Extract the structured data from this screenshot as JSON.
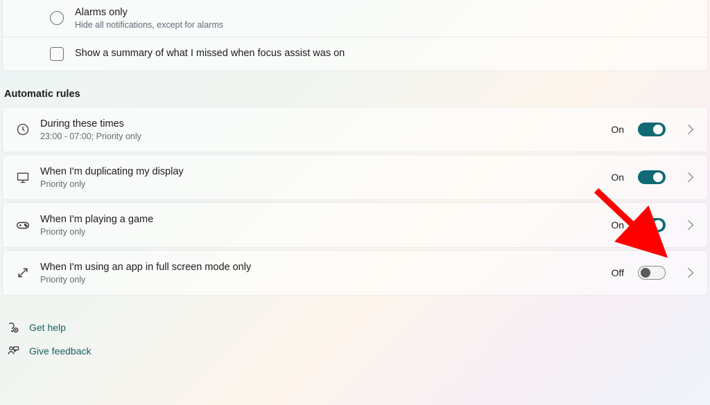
{
  "focus_options": {
    "alarms_only": {
      "title": "Alarms only",
      "subtitle": "Hide all notifications, except for alarms"
    },
    "summary_checkbox_label": "Show a summary of what I missed when focus assist was on"
  },
  "automatic_rules_header": "Automatic rules",
  "rules": [
    {
      "title": "During these times",
      "subtitle": "23:00 - 07:00; Priority only",
      "state_label": "On",
      "on": true,
      "icon": "clock"
    },
    {
      "title": "When I'm duplicating my display",
      "subtitle": "Priority only",
      "state_label": "On",
      "on": true,
      "icon": "monitor"
    },
    {
      "title": "When I'm playing a game",
      "subtitle": "Priority only",
      "state_label": "On",
      "on": true,
      "icon": "gamepad"
    },
    {
      "title": "When I'm using an app in full screen mode only",
      "subtitle": "Priority only",
      "state_label": "Off",
      "on": false,
      "icon": "fullscreen"
    }
  ],
  "links": {
    "help": "Get help",
    "feedback": "Give feedback"
  }
}
